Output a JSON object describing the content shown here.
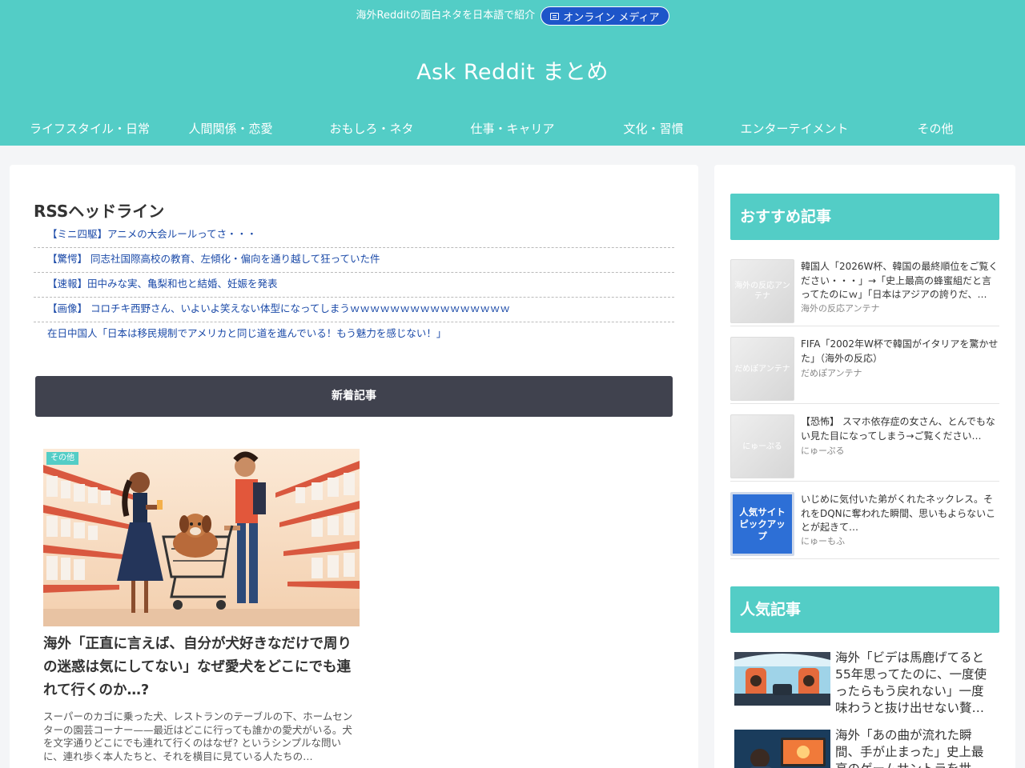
{
  "header": {
    "tagline": "海外Redditの面白ネタを日本語で紹介",
    "badge_label": "オンライン メディア",
    "site_title": "Ask Reddit まとめ"
  },
  "nav": [
    "ライフスタイル・日常",
    "人間関係・恋愛",
    "おもしろ・ネタ",
    "仕事・キャリア",
    "文化・習慣",
    "エンターテイメント",
    "その他"
  ],
  "rss": {
    "heading": "RSSヘッドライン",
    "items": [
      "【ミニ四駆】アニメの大会ルールってさ・・・",
      "【驚愕】 同志社国際高校の教育、左傾化・偏向を通り越して狂っていた件",
      "【速報】田中みな実、亀梨和也と結婚、妊娠を発表",
      "【画像】 コロチキ西野さん、いよいよ笑えない体型になってしまうｗｗｗｗｗｗｗｗｗｗｗｗｗｗｗｗ",
      "在日中国人「日本は移民規制でアメリカと同じ道を進んでいる！もう魅力を感じない！」"
    ]
  },
  "new_articles_label": "新着記事",
  "article": {
    "category": "その他",
    "title": "海外「正直に言えば、自分が犬好きなだけで周りの迷惑は気にしてない」なぜ愛犬をどこにでも連れて行くのか…?",
    "excerpt": "スーパーのカゴに乗った犬、レストランのテーブルの下、ホームセンターの園芸コーナー——最近はどこに行っても誰かの愛犬がいる。犬を文字通りどこにでも連れて行くのはなぜ? というシンプルな問いに、連れ歩く本人たちと、それを横目に見ている人たちの…"
  },
  "sidebar": {
    "recommended_heading": "おすすめ記事",
    "recommended": [
      {
        "thumb_text": "海外の反応アンテナ",
        "title": "韓国人「2026W杯、韓国の最終順位をご覧ください・・・」→「史上最高の蜂蜜組だと言ってたのにｗ」「日本はアジアの誇りだ、…",
        "source": "海外の反応アンテナ"
      },
      {
        "thumb_text": "だめぽアンテナ",
        "title": "FIFA「2002年W杯で韓国がイタリアを驚かせた」（海外の反応）",
        "source": "だめぽアンテナ"
      },
      {
        "thumb_text": "にゅーぷる",
        "title": "【恐怖】 スマホ依存症の女さん、とんでもない見た目になってしまう→ご覧ください…",
        "source": "にゅーぷる"
      },
      {
        "thumb_text": "人気サイトピックアップ",
        "title": "いじめに気付いた弟がくれたネックレス。それをDQNに奪われた瞬間、思いもよらないことが起きて…",
        "source": "にゅーもふ"
      }
    ],
    "popular_heading": "人気記事",
    "popular": [
      {
        "title": "海外「ビデは馬鹿げてると55年思ってたのに、一度使ったらもう戻れない」一度味わうと抜け出せない贅…"
      },
      {
        "title": "海外「あの曲が流れた瞬間、手が止まった」史上最高のゲームサントラを世界…"
      }
    ]
  },
  "colors": {
    "accent": "#53cdc6",
    "badge": "#1d55c9",
    "dark_bar": "#40424e",
    "link": "#1b4aa8"
  }
}
